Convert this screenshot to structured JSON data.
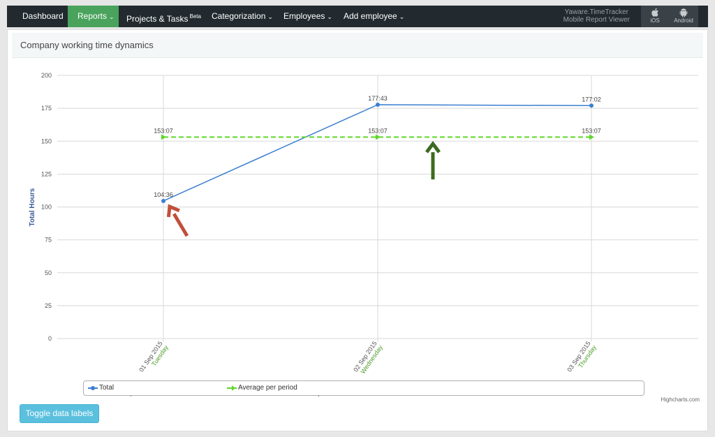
{
  "navbar": {
    "items": [
      {
        "label": "Dashboard",
        "has_menu": false
      },
      {
        "label": "Reports",
        "has_menu": true,
        "active": true
      },
      {
        "label": "Projects & Tasks",
        "badge": "Beta",
        "has_menu": false
      },
      {
        "label": "Categorization",
        "has_menu": true
      },
      {
        "label": "Employees",
        "has_menu": true
      },
      {
        "label": "Add employee",
        "has_menu": true
      }
    ],
    "brand_line1": "Yaware.TimeTracker",
    "brand_line2": "Mobile Report Viewer",
    "ios_label": "iOS",
    "android_label": "Android",
    "active_color": "#4aa35d"
  },
  "panel": {
    "title": "Company working time dynamics"
  },
  "toggle_button": "Toggle data labels",
  "credit": "Highcharts.com",
  "colors": {
    "total": "#3b7fd0",
    "average": "#5ed82a",
    "arrow_red": "#c0503a",
    "arrow_green": "#3b6b20"
  },
  "chart_data": {
    "type": "line",
    "ylabel": "Total Hours",
    "ylim": [
      0,
      200
    ],
    "yticks": [
      0,
      25,
      50,
      75,
      100,
      125,
      150,
      175,
      200
    ],
    "categories": [
      {
        "date": "01 Sep 2015",
        "day": "Tuesday"
      },
      {
        "date": "02 Sep 2015",
        "day": "Wednesday"
      },
      {
        "date": "03 Sep 2015",
        "day": "Thursday"
      }
    ],
    "series": [
      {
        "name": "Total",
        "values": [
          104.6,
          177.72,
          177.03
        ],
        "labels": [
          "104:36",
          "177:43",
          "177:02"
        ],
        "dashed": false
      },
      {
        "name": "Average per period",
        "values": [
          153.12,
          153.12,
          153.12
        ],
        "labels": [
          "153:07",
          "153:07",
          "153:07"
        ],
        "dashed": true
      }
    ],
    "legend_placement": "bottom",
    "grid": true
  }
}
